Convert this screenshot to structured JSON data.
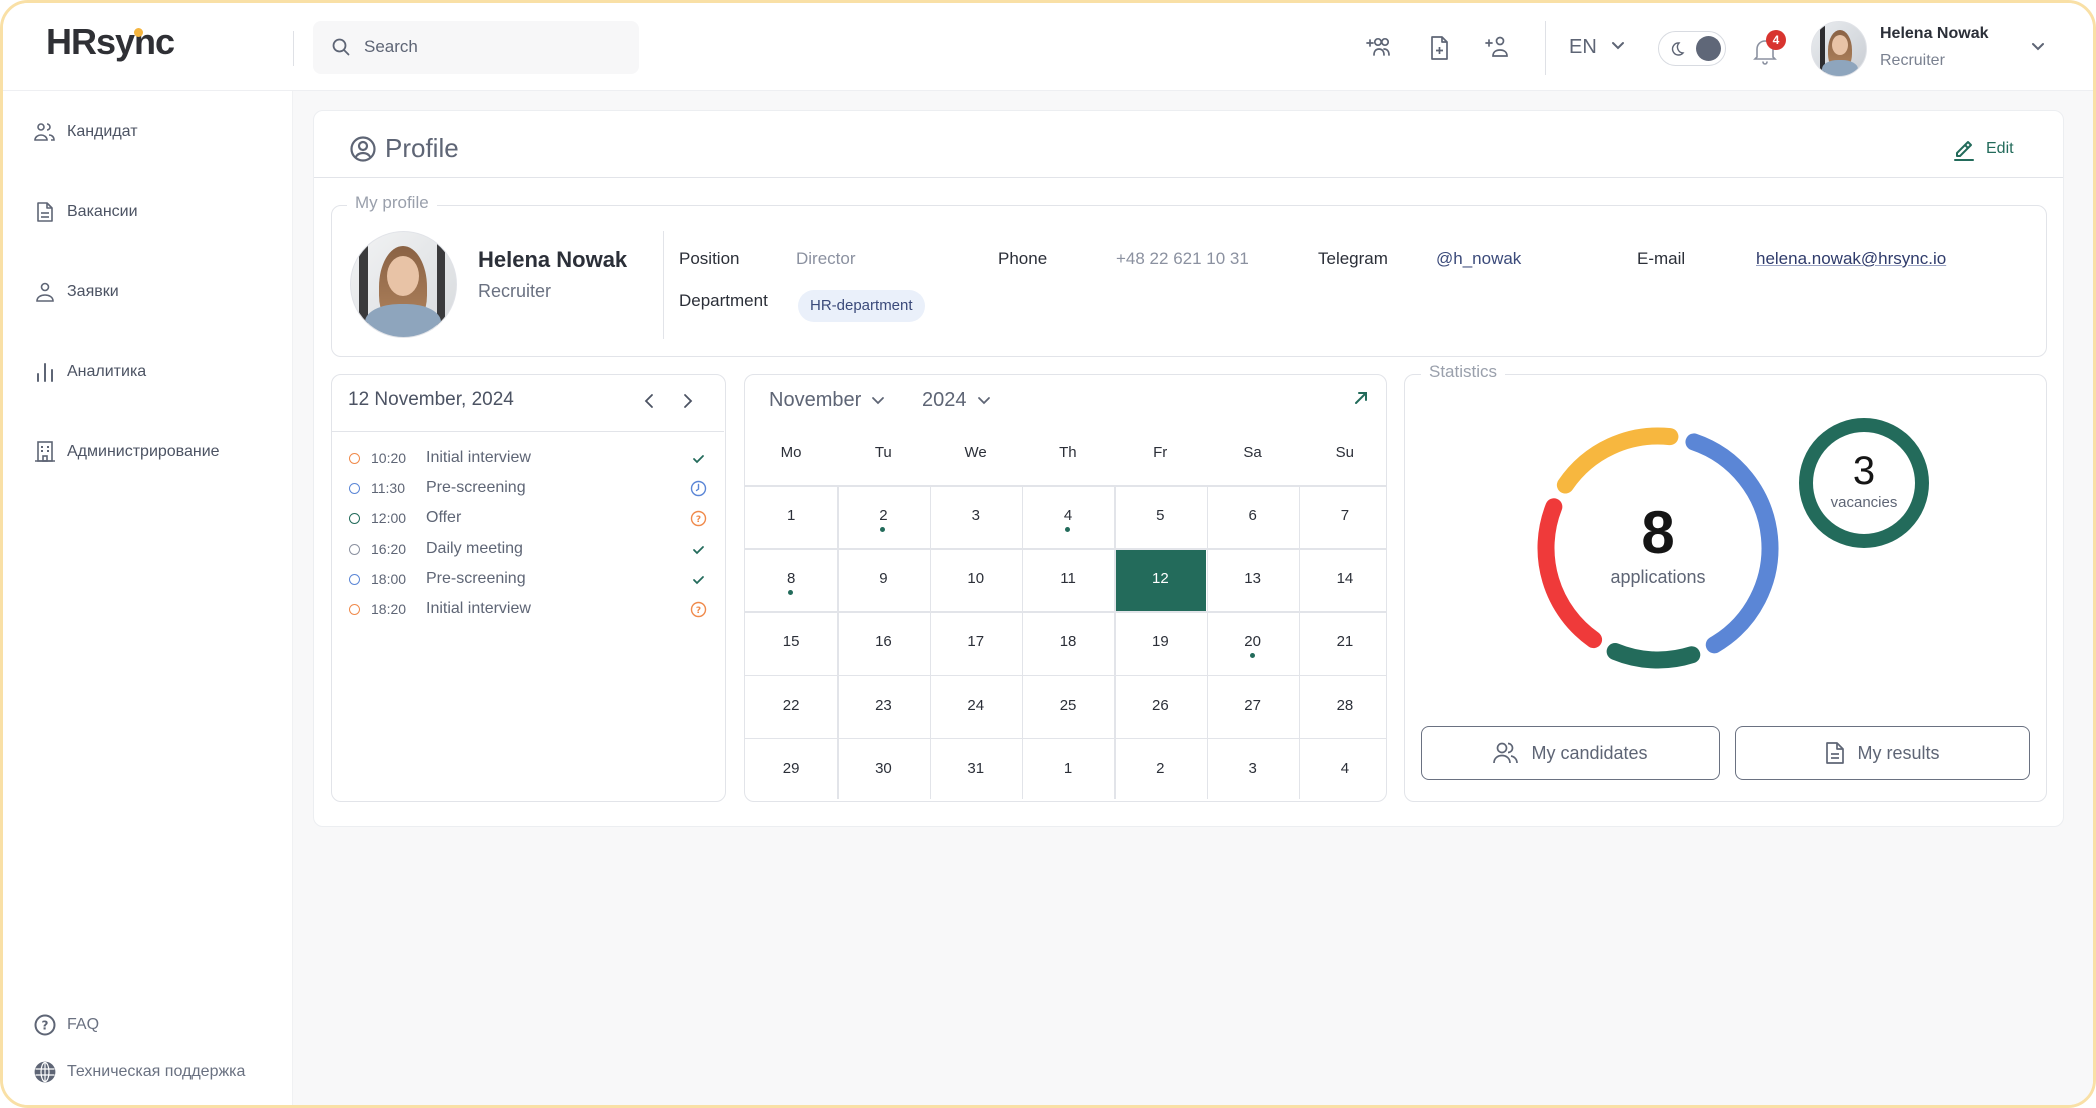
{
  "app": {
    "logo": "HRsync"
  },
  "header": {
    "search_placeholder": "Search",
    "icons": [
      "add-group-icon",
      "add-document-icon",
      "add-user-icon"
    ],
    "language": "EN",
    "theme_toggle": "dark-mode",
    "notifications_count": "4",
    "user": {
      "name": "Helena Nowak",
      "role": "Recruiter"
    }
  },
  "sidebar": {
    "items": [
      {
        "label": "Кандидат",
        "icon": "users-icon"
      },
      {
        "label": "Вакансии",
        "icon": "document-icon"
      },
      {
        "label": "Заявки",
        "icon": "user-icon"
      },
      {
        "label": "Аналитика",
        "icon": "bar-chart-icon"
      },
      {
        "label": "Администрирование",
        "icon": "building-icon"
      }
    ],
    "footer": [
      {
        "label": "FAQ",
        "icon": "help-circle-icon"
      },
      {
        "label": "Техническая поддержка",
        "icon": "globe-icon"
      }
    ]
  },
  "profile": {
    "title": "Profile",
    "edit_label": "Edit",
    "section_label": "My profile",
    "name": "Helena Nowak",
    "role": "Recruiter",
    "fields": {
      "position_label": "Position",
      "position_value": "Director",
      "department_label": "Department",
      "department_value": "HR-department",
      "phone_label": "Phone",
      "phone_value": "+48 22 621 10 31",
      "telegram_label": "Telegram",
      "telegram_value": "@h_nowak",
      "email_label": "E-mail",
      "email_value": "helena.nowak@hrsync.io"
    }
  },
  "schedule": {
    "date": "12 November, 2024",
    "events": [
      {
        "time": "10:20",
        "title": "Initial interview",
        "color": "#f08a4b",
        "status": "done"
      },
      {
        "time": "11:30",
        "title": "Pre-screening",
        "color": "#5b86d6",
        "status": "pending"
      },
      {
        "time": "12:00",
        "title": "Offer",
        "color": "#236b5b",
        "status": "unknown"
      },
      {
        "time": "16:20",
        "title": "Daily meeting",
        "color": "#8b91a0",
        "status": "done"
      },
      {
        "time": "18:00",
        "title": "Pre-screening",
        "color": "#5b86d6",
        "status": "done"
      },
      {
        "time": "18:20",
        "title": "Initial interview",
        "color": "#f08a4b",
        "status": "unknown"
      }
    ]
  },
  "calendar": {
    "month": "November",
    "year": "2024",
    "weekdays": [
      "Mo",
      "Tu",
      "We",
      "Th",
      "Fr",
      "Sa",
      "Su"
    ],
    "days": [
      {
        "d": "1"
      },
      {
        "d": "2",
        "dot": true
      },
      {
        "d": "3"
      },
      {
        "d": "4",
        "dot": true
      },
      {
        "d": "5"
      },
      {
        "d": "6"
      },
      {
        "d": "7"
      },
      {
        "d": "8",
        "dot": true
      },
      {
        "d": "9"
      },
      {
        "d": "10"
      },
      {
        "d": "11"
      },
      {
        "d": "12",
        "selected": true
      },
      {
        "d": "13"
      },
      {
        "d": "14"
      },
      {
        "d": "15"
      },
      {
        "d": "16"
      },
      {
        "d": "17"
      },
      {
        "d": "18"
      },
      {
        "d": "19"
      },
      {
        "d": "20",
        "dot": true
      },
      {
        "d": "21"
      },
      {
        "d": "22"
      },
      {
        "d": "23"
      },
      {
        "d": "24"
      },
      {
        "d": "25"
      },
      {
        "d": "26"
      },
      {
        "d": "27"
      },
      {
        "d": "28"
      },
      {
        "d": "29"
      },
      {
        "d": "30"
      },
      {
        "d": "31"
      },
      {
        "d": "1"
      },
      {
        "d": "2"
      },
      {
        "d": "3"
      },
      {
        "d": "4"
      }
    ],
    "accent": "#236b5b"
  },
  "statistics": {
    "title": "Statistics",
    "applications": {
      "count": "8",
      "label": "applications"
    },
    "vacancies": {
      "count": "3",
      "label": "vacancies"
    },
    "segments": [
      {
        "color": "#f7b73f",
        "share": 0.17
      },
      {
        "color": "#5b86d6",
        "share": 0.36
      },
      {
        "color": "#236b5b",
        "share": 0.11
      },
      {
        "color": "#ef3a3a",
        "share": 0.21
      }
    ],
    "buttons": {
      "candidates": "My candidates",
      "results": "My results"
    }
  }
}
